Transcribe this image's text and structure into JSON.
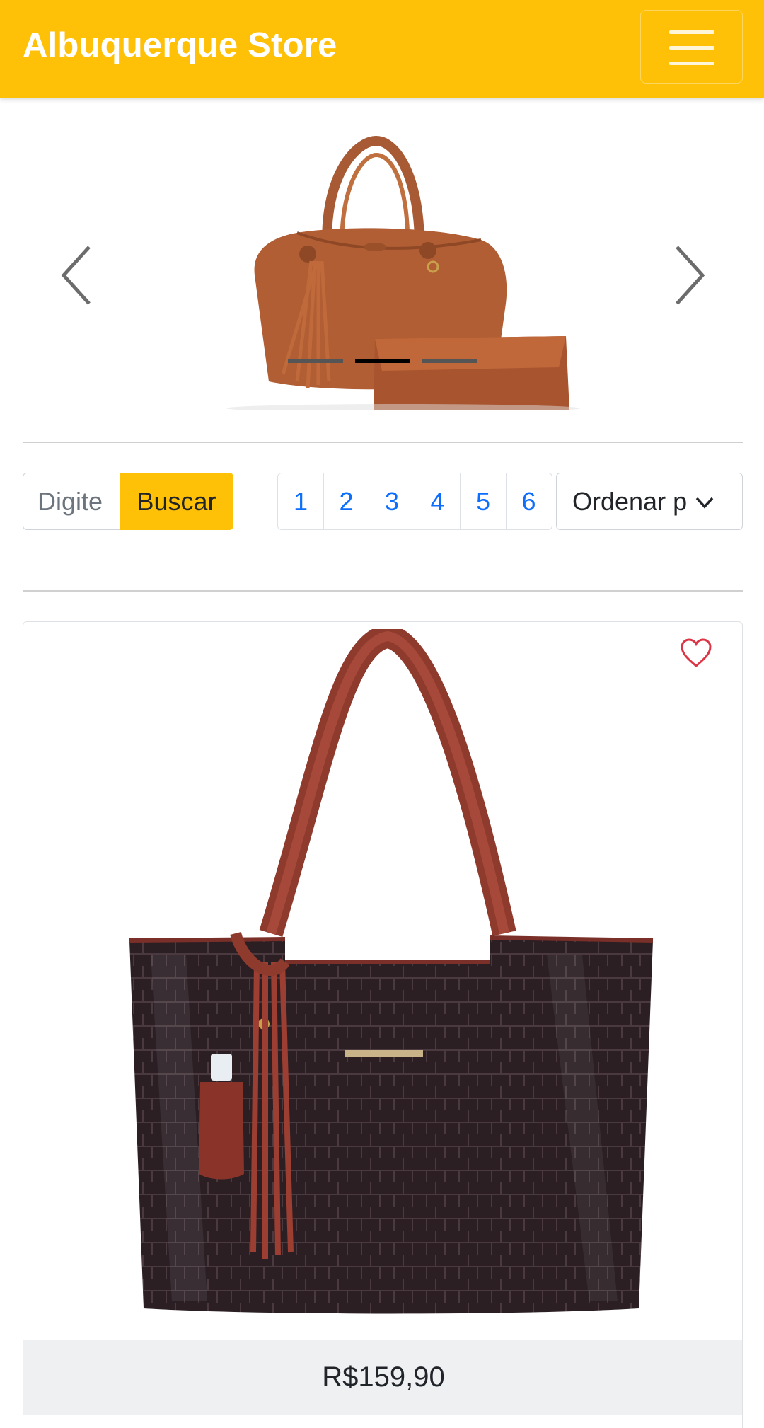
{
  "navbar": {
    "brand": "Albuquerque Store",
    "brand_color": "#ffc107"
  },
  "carousel": {
    "slide_count": 3,
    "active_slide": 2
  },
  "search": {
    "placeholder": "Digite",
    "button_label": "Buscar"
  },
  "pagination": {
    "pages": [
      "1",
      "2",
      "3",
      "4",
      "5",
      "6"
    ]
  },
  "sort": {
    "selected": "Ordenar p"
  },
  "products": [
    {
      "price": "R$159,90",
      "image": "dark-croc-tote-bag",
      "favorite_icon": "heart-outline-icon"
    }
  ]
}
